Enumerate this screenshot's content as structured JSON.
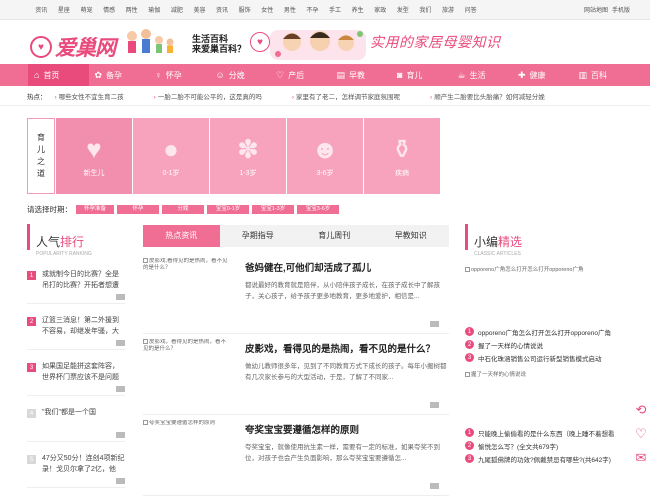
{
  "topbar": {
    "links": [
      "资讯",
      "星座",
      "萌宠",
      "情感",
      "两性",
      "瑜伽",
      "减肥",
      "美容",
      "资讯",
      "服饰",
      "女性",
      "男性",
      "不孕",
      "手工",
      "养生",
      "家政",
      "发型",
      "我们",
      "旅游",
      "问答"
    ],
    "right": [
      "网站地图",
      "手机版"
    ]
  },
  "header": {
    "logo_text": "爱巢网",
    "logo_mark": "♥",
    "slogan_line1": "生活百科",
    "slogan_line2": "来爱巢百科？",
    "tagline": "实用的家居母婴知识"
  },
  "nav": {
    "items": [
      {
        "label": "首页",
        "icon": "home-icon",
        "glyph": "⌂"
      },
      {
        "label": "备孕",
        "icon": "prepare-icon",
        "glyph": "✿"
      },
      {
        "label": "怀孕",
        "icon": "pregnancy-icon",
        "glyph": "♀"
      },
      {
        "label": "分娩",
        "icon": "delivery-icon",
        "glyph": "☺"
      },
      {
        "label": "产后",
        "icon": "postpartum-icon",
        "glyph": "♡"
      },
      {
        "label": "早教",
        "icon": "book-icon",
        "glyph": "▤"
      },
      {
        "label": "育儿",
        "icon": "parenting-icon",
        "glyph": "◙"
      },
      {
        "label": "生活",
        "icon": "life-icon",
        "glyph": "☕"
      },
      {
        "label": "健康",
        "icon": "health-icon",
        "glyph": "✚"
      },
      {
        "label": "百科",
        "icon": "encyclopedia-icon",
        "glyph": "▥"
      }
    ]
  },
  "hotline": {
    "label": "热点：",
    "items": [
      "哪些女性不宜生育二孩",
      "一胎二胎不可能公平的，这是真的吗",
      "家里有了老二，怎样调节家庭氛围呢",
      "顺产生二胎要比头胎痛？如何减轻分娩"
    ]
  },
  "stage": {
    "label_chars": [
      "育",
      "儿",
      "之",
      "道"
    ],
    "cells": [
      {
        "label": "新生儿",
        "icon": "newborn-icon",
        "glyph": "♥"
      },
      {
        "label": "0-1岁",
        "icon": "infant-icon",
        "glyph": "●"
      },
      {
        "label": "1-3岁",
        "icon": "toddler-icon",
        "glyph": "✽"
      },
      {
        "label": "3-6岁",
        "icon": "child-icon",
        "glyph": "☻"
      },
      {
        "label": "疾病",
        "icon": "iv-drip-icon",
        "glyph": "⚱"
      }
    ]
  },
  "period": {
    "label": "请选择时期：",
    "buttons": [
      "怀孕准备",
      "怀孕",
      "分娩",
      "宝宝0-1岁",
      "宝宝1-3岁",
      "宝宝3-6岁"
    ]
  },
  "popular": {
    "title_a": "人气",
    "title_b": "排行",
    "subtitle": "POPULARITY RANKING",
    "items": [
      {
        "num": "1",
        "text": "或就制今日的比赛？全是吊打的比赛？开拓者想遭"
      },
      {
        "num": "2",
        "text": "辽篮三消息！第二外援到不容易，却继发年骚，大"
      },
      {
        "num": "3",
        "text": "如果国足能拼这套阵容，世界杯门票应该不是问题"
      },
      {
        "num": "4",
        "text": "\"我们\"都是一个国"
      },
      {
        "num": "5",
        "text": "47分又50分！连创4项新纪录！戈贝尔拿了2亿，他"
      }
    ]
  },
  "tabs": [
    "热点资讯",
    "孕期指导",
    "育儿周刊",
    "早教知识"
  ],
  "articles": [
    {
      "thumb_alt": "皮影戏,看得见的是热闹，看不见的是什么？",
      "title": "爸妈健在,可他们却活成了孤儿",
      "desc": "都说最好的教育就是陪伴，从小陪伴孩子成长，在孩子成长中了解孩子，关心孩子，给予孩子更多地教育，更多地爱护，相信是..."
    },
    {
      "thumb_alt": "皮影戏，看得见的是热闹，看不见的是什么？",
      "title": "皮影戏，看得见的是热闹，看不见的是什么？",
      "desc": "做幼儿教师很多年，见到了不同教育方式下成长的孩子。每年小搬树都有几次家长参与的大型活动，于是，了解了不同家..."
    },
    {
      "thumb_alt": "夸奖宝宝要遵循怎样的原则",
      "title": "夸奖宝宝要遵循怎样的原则",
      "desc": "夸奖宝宝，就像使用抗生素一样，需要有一定的标准，如果夸奖不到位，对孩子也会产生负面影响，那么夸奖宝宝要遵循怎..."
    }
  ],
  "editor": {
    "title_a": "小编",
    "title_b": "精选",
    "subtitle": "CLASSIC ARTICLES",
    "img1_alt": "opporeno广角怎么打开怎么打开opporeno广角",
    "list1": [
      {
        "num": "1",
        "text": "opporeno广角怎么打开怎么打开opporeno广角"
      },
      {
        "num": "2",
        "text": "握了一天样的心情说说"
      },
      {
        "num": "3",
        "text": "中石化珠涵销售公司运行新型销售模式启动"
      }
    ],
    "img2_alt": "握了一天样的心情说说",
    "list2": [
      {
        "num": "1",
        "text": "只能晚上偷偷看的是什么东西（晚上睡不着想看"
      },
      {
        "num": "2",
        "text": "愉悦怎么写？(全文共679字)"
      },
      {
        "num": "3",
        "text": "九尾狐佛牌的功效?佩戴禁忌有哪些?(共642字)"
      }
    ]
  },
  "colors": {
    "brand": "#e94b7d",
    "nav": "#f06e94",
    "tile": "#f7a3bd"
  }
}
